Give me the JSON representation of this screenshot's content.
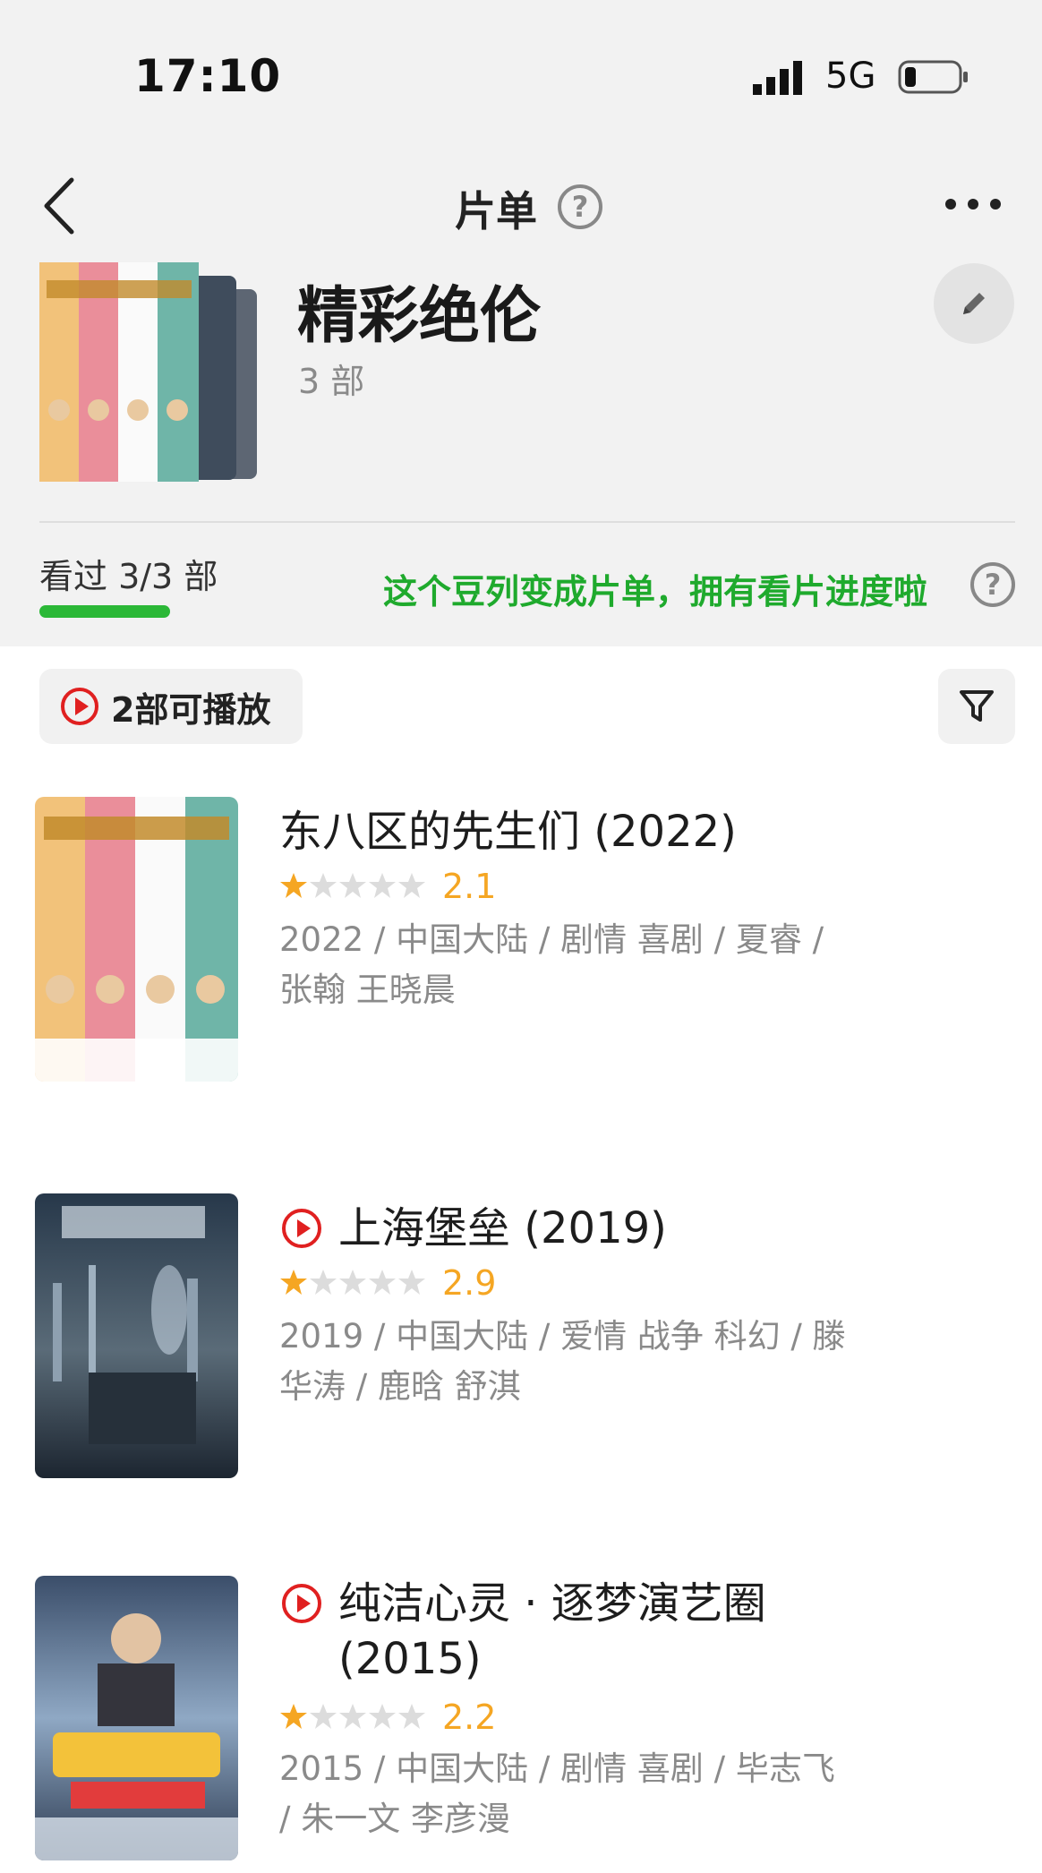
{
  "status_bar": {
    "time": "17:10",
    "network": "5G"
  },
  "nav": {
    "title": "片单"
  },
  "list": {
    "title": "精彩绝伦",
    "count": "3 部",
    "watched": "看过 3/3 部",
    "watched_progress": 1.0,
    "promo": "这个豆列变成片单，拥有看片进度啦"
  },
  "filter": {
    "playable_label": "2部可播放"
  },
  "movies": [
    {
      "title": "东八区的先生们 (2022)",
      "playable": false,
      "rating": "2.1",
      "stars": 1,
      "meta": "2022 / 中国大陆 / 剧情 喜剧 / 夏睿 / 张翰 王晓晨"
    },
    {
      "title": "上海堡垒 (2019)",
      "playable": true,
      "rating": "2.9",
      "stars": 1.5,
      "meta": "2019 / 中国大陆 / 爱情 战争 科幻 / 滕华涛 / 鹿晗 舒淇"
    },
    {
      "title": "纯洁心灵 · 逐梦演艺圈 (2015)",
      "playable": true,
      "rating": "2.2",
      "stars": 1,
      "meta": "2015 / 中国大陆 / 剧情 喜剧 / 毕志飞 / 朱一文 李彦漫"
    }
  ],
  "colors": {
    "accent_green": "#2bb837",
    "promo_green": "#1faa2d",
    "star": "#f5a623",
    "play_red": "#e02020"
  }
}
